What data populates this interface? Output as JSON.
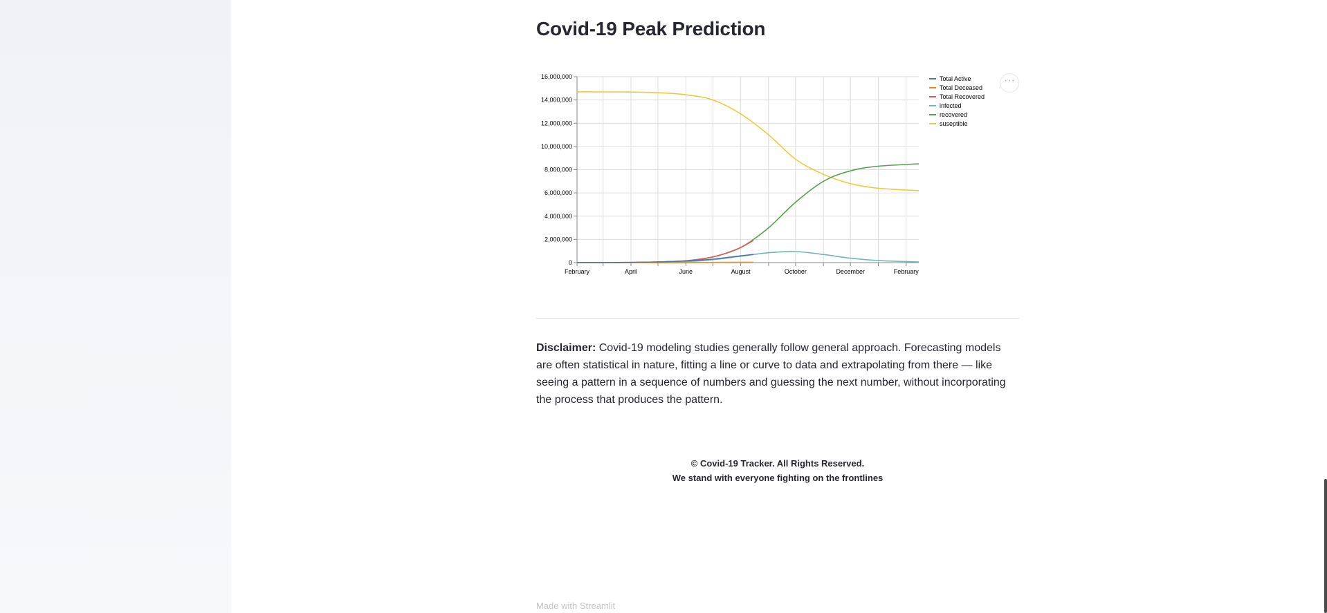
{
  "page": {
    "title": "Covid-19 Peak Prediction",
    "menu_icon": "more-horizontal-icon",
    "disclaimer_label": "Disclaimer:",
    "disclaimer_text": " Covid-19 modeling studies generally follow general approach. Forecasting models are often statistical in nature, fitting a line or curve to data and extrapolating from there — like seeing a pattern in a sequence of numbers and guessing the next number, without incorporating the process that produces the pattern.",
    "footer_line1": "© Covid-19 Tracker. All Rights Reserved.",
    "footer_line2": "We stand with everyone fighting on the frontlines",
    "made_with": "Made with Streamlit"
  },
  "chart_data": {
    "type": "line",
    "title": "",
    "xlabel": "",
    "ylabel": "",
    "x_tick_labels": [
      "February",
      "April",
      "June",
      "August",
      "October",
      "December",
      "February"
    ],
    "y_ticks": [
      0,
      2000000,
      4000000,
      6000000,
      8000000,
      10000000,
      12000000,
      14000000,
      16000000
    ],
    "y_tick_labels": [
      "0",
      "2,000,000",
      "4,000,000",
      "6,000,000",
      "8,000,000",
      "10,000,000",
      "12,000,000",
      "14,000,000",
      "16,000,000"
    ],
    "xlim": [
      "2020-02-01",
      "2021-02-15"
    ],
    "ylim": [
      0,
      16000000
    ],
    "grid": true,
    "legend_position": "right",
    "series": [
      {
        "name": "Total Active",
        "color": "#4c78a8",
        "x": [
          "2020-02-01",
          "2020-03-01",
          "2020-04-01",
          "2020-05-01",
          "2020-06-01",
          "2020-06-15",
          "2020-07-01",
          "2020-07-15",
          "2020-08-01",
          "2020-08-15"
        ],
        "y": [
          0,
          2000,
          20000,
          60000,
          140000,
          200000,
          300000,
          420000,
          580000,
          700000
        ]
      },
      {
        "name": "Total Deceased",
        "color": "#f58518",
        "x": [
          "2020-02-01",
          "2020-04-01",
          "2020-06-01",
          "2020-08-15"
        ],
        "y": [
          0,
          2000,
          8000,
          35000
        ]
      },
      {
        "name": "Total Recovered",
        "color": "#e45756",
        "x": [
          "2020-02-01",
          "2020-04-01",
          "2020-05-01",
          "2020-06-01",
          "2020-07-01",
          "2020-07-15",
          "2020-08-01",
          "2020-08-15"
        ],
        "y": [
          0,
          15000,
          60000,
          160000,
          480000,
          800000,
          1300000,
          1900000
        ]
      },
      {
        "name": "infected",
        "color": "#72b7b2",
        "x": [
          "2020-02-01",
          "2020-04-01",
          "2020-06-01",
          "2020-07-01",
          "2020-08-01",
          "2020-09-01",
          "2020-10-01",
          "2020-11-01",
          "2020-12-01",
          "2021-01-01",
          "2021-02-15"
        ],
        "y": [
          0,
          10000,
          90000,
          250000,
          550000,
          850000,
          950000,
          700000,
          380000,
          180000,
          60000
        ]
      },
      {
        "name": "recovered",
        "color": "#54a24b",
        "x": [
          "2020-02-01",
          "2020-04-01",
          "2020-06-01",
          "2020-07-01",
          "2020-08-01",
          "2020-09-01",
          "2020-10-01",
          "2020-11-01",
          "2020-12-01",
          "2021-01-01",
          "2021-02-15"
        ],
        "y": [
          0,
          10000,
          150000,
          500000,
          1300000,
          3000000,
          5200000,
          7000000,
          7900000,
          8300000,
          8500000
        ]
      },
      {
        "name": "suseptible",
        "color": "#eeca3b",
        "x": [
          "2020-02-01",
          "2020-04-01",
          "2020-05-01",
          "2020-06-01",
          "2020-07-01",
          "2020-08-01",
          "2020-09-01",
          "2020-10-01",
          "2020-11-01",
          "2020-12-01",
          "2021-01-01",
          "2021-02-15"
        ],
        "y": [
          14700000,
          14680000,
          14620000,
          14450000,
          14000000,
          12800000,
          11000000,
          8900000,
          7600000,
          6800000,
          6400000,
          6200000
        ]
      }
    ]
  }
}
